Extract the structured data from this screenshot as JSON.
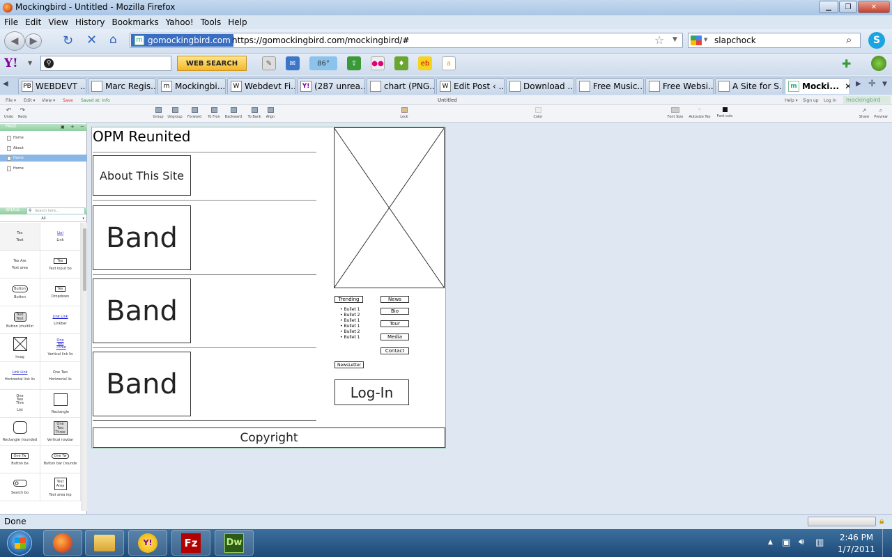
{
  "window": {
    "title": "Mockingbird - Untitled - Mozilla Firefox"
  },
  "menu": [
    "File",
    "Edit",
    "View",
    "History",
    "Bookmarks",
    "Yahoo!",
    "Tools",
    "Help"
  ],
  "navbar": {
    "site_label": "gomockingbird.com",
    "url": "https://gomockingbird.com/mockingbird/#",
    "search_value": "slapchock"
  },
  "yahoo": {
    "logo": "Y!",
    "web_search": "WEB SEARCH",
    "weather": "86°"
  },
  "tabs": [
    {
      "label": "WEBDEVT ...",
      "icon": "PB"
    },
    {
      "label": "Marc Regis...",
      "icon": ""
    },
    {
      "label": "Mockingbi...",
      "icon": "m"
    },
    {
      "label": "Webdevt Fi...",
      "icon": "W"
    },
    {
      "label": "(287 unrea...",
      "icon": "Y!"
    },
    {
      "label": "chart (PNG...",
      "icon": ""
    },
    {
      "label": "Edit Post ‹ ...",
      "icon": "W"
    },
    {
      "label": "Download ...",
      "icon": ""
    },
    {
      "label": "Free Music...",
      "icon": ""
    },
    {
      "label": "Free Websi...",
      "icon": ""
    },
    {
      "label": "A Site for S...",
      "icon": ""
    },
    {
      "label": "Mocki...",
      "icon": "m"
    }
  ],
  "app": {
    "menu": [
      "File ▾",
      "Edit ▾",
      "View ▾",
      "Save",
      "Saved at: Info"
    ],
    "doc_title": "Untitled",
    "right_menu": [
      "Help ▾",
      "Sign up",
      "Log in"
    ],
    "brand": "mockingbird",
    "toolbar_left": [
      "Undo",
      "Redo"
    ],
    "toolbar_mid": [
      "Group",
      "Ungroup",
      "Forward",
      "To Fron",
      "Backward",
      "To Back",
      "Align"
    ],
    "lock": "Lock",
    "color": "Color",
    "font_tools": [
      "Font Size",
      "Autosize Tex",
      "Font colo"
    ],
    "right_tools": [
      "Share",
      "Preview"
    ]
  },
  "sidebar": {
    "pages_header": "PAGE",
    "pages": [
      "Home",
      "About",
      "Home",
      "Home"
    ],
    "widgets_header": "WIDGE",
    "search_placeholder": "Search here...",
    "filter": "All",
    "widgets": [
      {
        "name": "Text",
        "icon": "Tex"
      },
      {
        "name": "Link",
        "icon": "Lini"
      },
      {
        "name": "Text area",
        "icon": "Tex Are"
      },
      {
        "name": "Text input bo",
        "icon": "Tex"
      },
      {
        "name": "Button",
        "icon": "Button"
      },
      {
        "name": "Dropdown",
        "icon": "Yes"
      },
      {
        "name": "Button (multilin",
        "icon": "Text Text"
      },
      {
        "name": "Linkbar",
        "icon": "Link Link"
      },
      {
        "name": "Imag",
        "icon": ""
      },
      {
        "name": "Vertical link lis",
        "icon": "One Two Three"
      },
      {
        "name": "Horizontal link lis",
        "icon": "Link Link"
      },
      {
        "name": "Horizontal lis",
        "icon": "One Two"
      },
      {
        "name": "List",
        "icon": "One Two Thre"
      },
      {
        "name": "Rectangle",
        "icon": ""
      },
      {
        "name": "Rectangle (rounded",
        "icon": ""
      },
      {
        "name": "Vertical navbar",
        "icon": "One Two Three"
      },
      {
        "name": "Button ba",
        "icon": "One Tw"
      },
      {
        "name": "Button bar (rounde",
        "icon": "One Tw"
      },
      {
        "name": "Search bo",
        "icon": ""
      },
      {
        "name": "Text area inp",
        "icon": "Text Area"
      }
    ]
  },
  "mockup": {
    "title": "OPM Reunited",
    "about": "About This Site",
    "bands": [
      "Band",
      "Band",
      "Band"
    ],
    "trending": "Trending",
    "bullets": [
      "Bullet 1",
      "Bullet 2",
      "Bullet 1",
      "Bullet 1",
      "Bullet 2",
      "Bullet 1"
    ],
    "nav": [
      "News",
      "Bio",
      "Tour",
      "Media",
      "Contact"
    ],
    "newsletter": "NewsLetter",
    "login": "Log-In",
    "copyright": "Copyright"
  },
  "status": {
    "text": "Done"
  },
  "clock": {
    "time": "2:46 PM",
    "date": "1/7/2011"
  },
  "taskbar": [
    "Firefox",
    "Explorer",
    "Yahoo Messenger",
    "FileZilla",
    "Dreamweaver"
  ]
}
